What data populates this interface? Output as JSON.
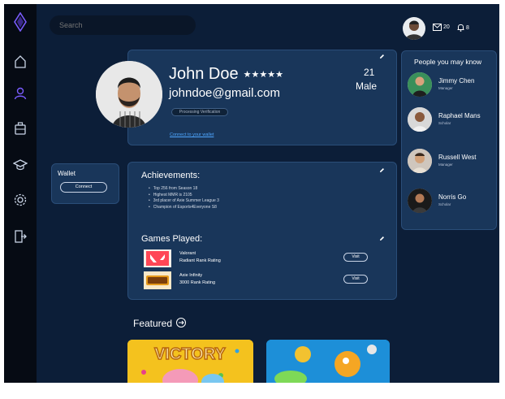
{
  "search": {
    "placeholder": "Search"
  },
  "sidebar": {
    "icons": [
      "logo-crystal-icon",
      "home-icon",
      "user-icon",
      "briefcase-icon",
      "graduation-cap-icon",
      "gear-icon",
      "logout-icon"
    ],
    "accent": "#7a5cff"
  },
  "topbar": {
    "mail_count": "20",
    "bell_count": "8"
  },
  "profile": {
    "name": "John Doe",
    "stars": "★★★★★",
    "email": "johndoe@gmail.com",
    "verification": "Processing Verification",
    "connect_wallet": "Connect to your wallet",
    "age": "21",
    "gender": "Male"
  },
  "wallet": {
    "label": "Wallet",
    "button": "Connect"
  },
  "achievements": {
    "title": "Achievements:",
    "items": [
      "Top 256 from Season 18",
      "Highest MMR is 2105",
      "3rd placer of Axie Summer League 3",
      "Champion of Esports4Everyone S8"
    ]
  },
  "games": {
    "title": "Games Played:",
    "items": [
      {
        "name": "Valorant",
        "rating": "Radiant Rank Rating",
        "button": "Visit"
      },
      {
        "name": "Axie Infinity",
        "rating": "3000 Rank Rating",
        "button": "Visit"
      }
    ]
  },
  "people": {
    "title": "People you may know",
    "items": [
      {
        "name": "Jimmy Chen",
        "role": "Manager"
      },
      {
        "name": "Raphael Mans",
        "role": "Scholar"
      },
      {
        "name": "Russell West",
        "role": "Manager"
      },
      {
        "name": "Norris Go",
        "role": "Scholar"
      }
    ]
  },
  "featured": {
    "title": "Featured",
    "tiles": [
      {
        "text": "VICTORY"
      },
      {
        "text": ""
      }
    ]
  },
  "colors": {
    "background": "#0c1e38",
    "card": "#19365a",
    "sidebar": "#060b14",
    "link": "#4ea6ff"
  }
}
